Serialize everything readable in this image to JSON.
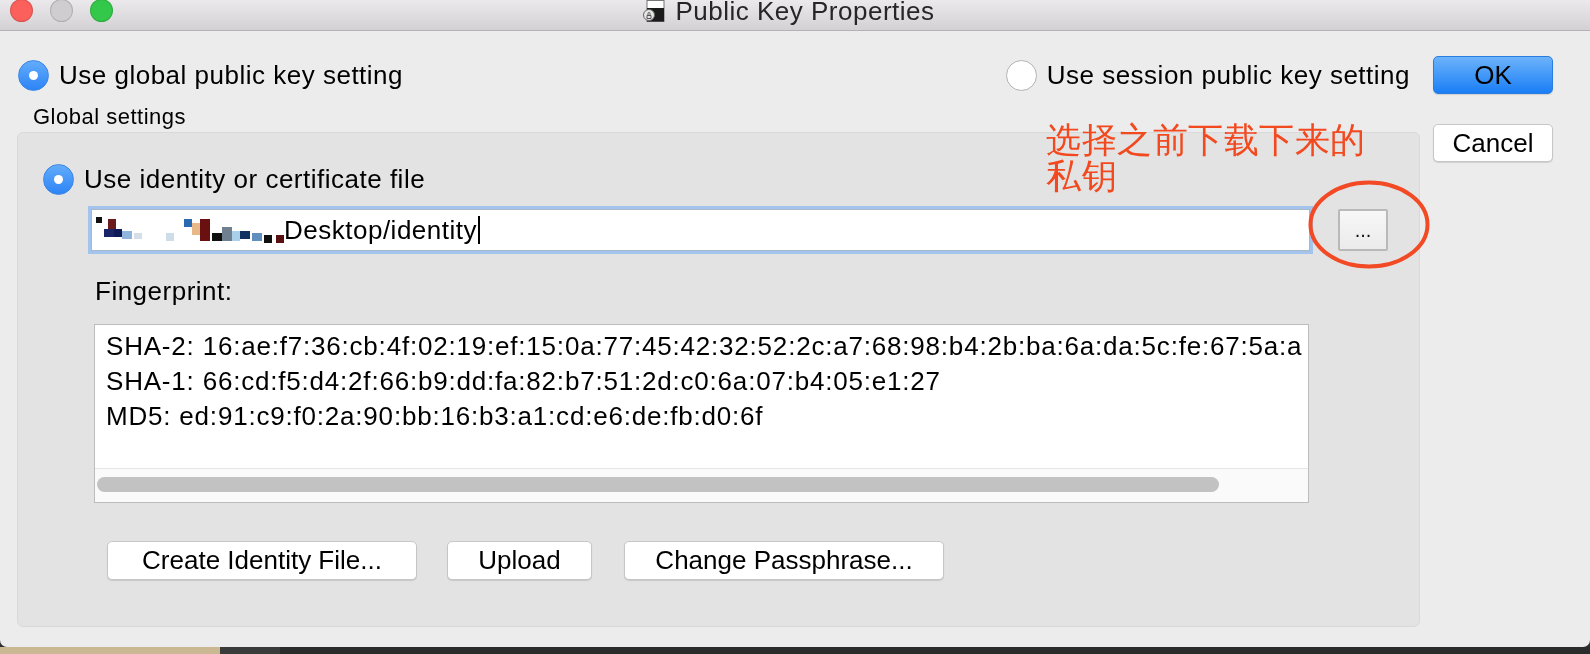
{
  "window": {
    "title": "Public Key Properties",
    "controls": [
      {
        "kind": "close",
        "disabled": false
      },
      {
        "kind": "minimize",
        "disabled": true
      },
      {
        "kind": "zoom",
        "disabled": false
      }
    ]
  },
  "scope_options": [
    {
      "label": "Use global public key setting",
      "selected": true
    },
    {
      "label": "Use session public key setting",
      "selected": false
    }
  ],
  "dialog_buttons": [
    {
      "label": "OK",
      "kind": "default"
    },
    {
      "label": "Cancel",
      "kind": "normal"
    }
  ],
  "global_settings": {
    "title": "Global settings",
    "source_options": [
      {
        "label": "Use identity or certificate file",
        "selected": true
      }
    ],
    "identity_file": {
      "value": "Desktop/identity",
      "browse_label": "..."
    },
    "fingerprint": {
      "label": "Fingerprint:",
      "lines": [
        "SHA-2: 16:ae:f7:36:cb:4f:02:19:ef:15:0a:77:45:42:32:52:2c:a7:68:98:b4:2b:ba:6a:da:5c:fe:67:5a:a",
        "SHA-1: 66:cd:f5:d4:2f:66:b9:dd:fa:82:b7:51:2d:c0:6a:07:b4:05:e1:27",
        "MD5: ed:91:c9:f0:2a:90:bb:16:b3:a1:cd:e6:de:fb:d0:6f"
      ]
    },
    "actions": [
      "Create Identity File...",
      "Upload",
      "Change Passphrase..."
    ]
  },
  "annotation": {
    "text": "选择之前下载下来的私钥"
  }
}
